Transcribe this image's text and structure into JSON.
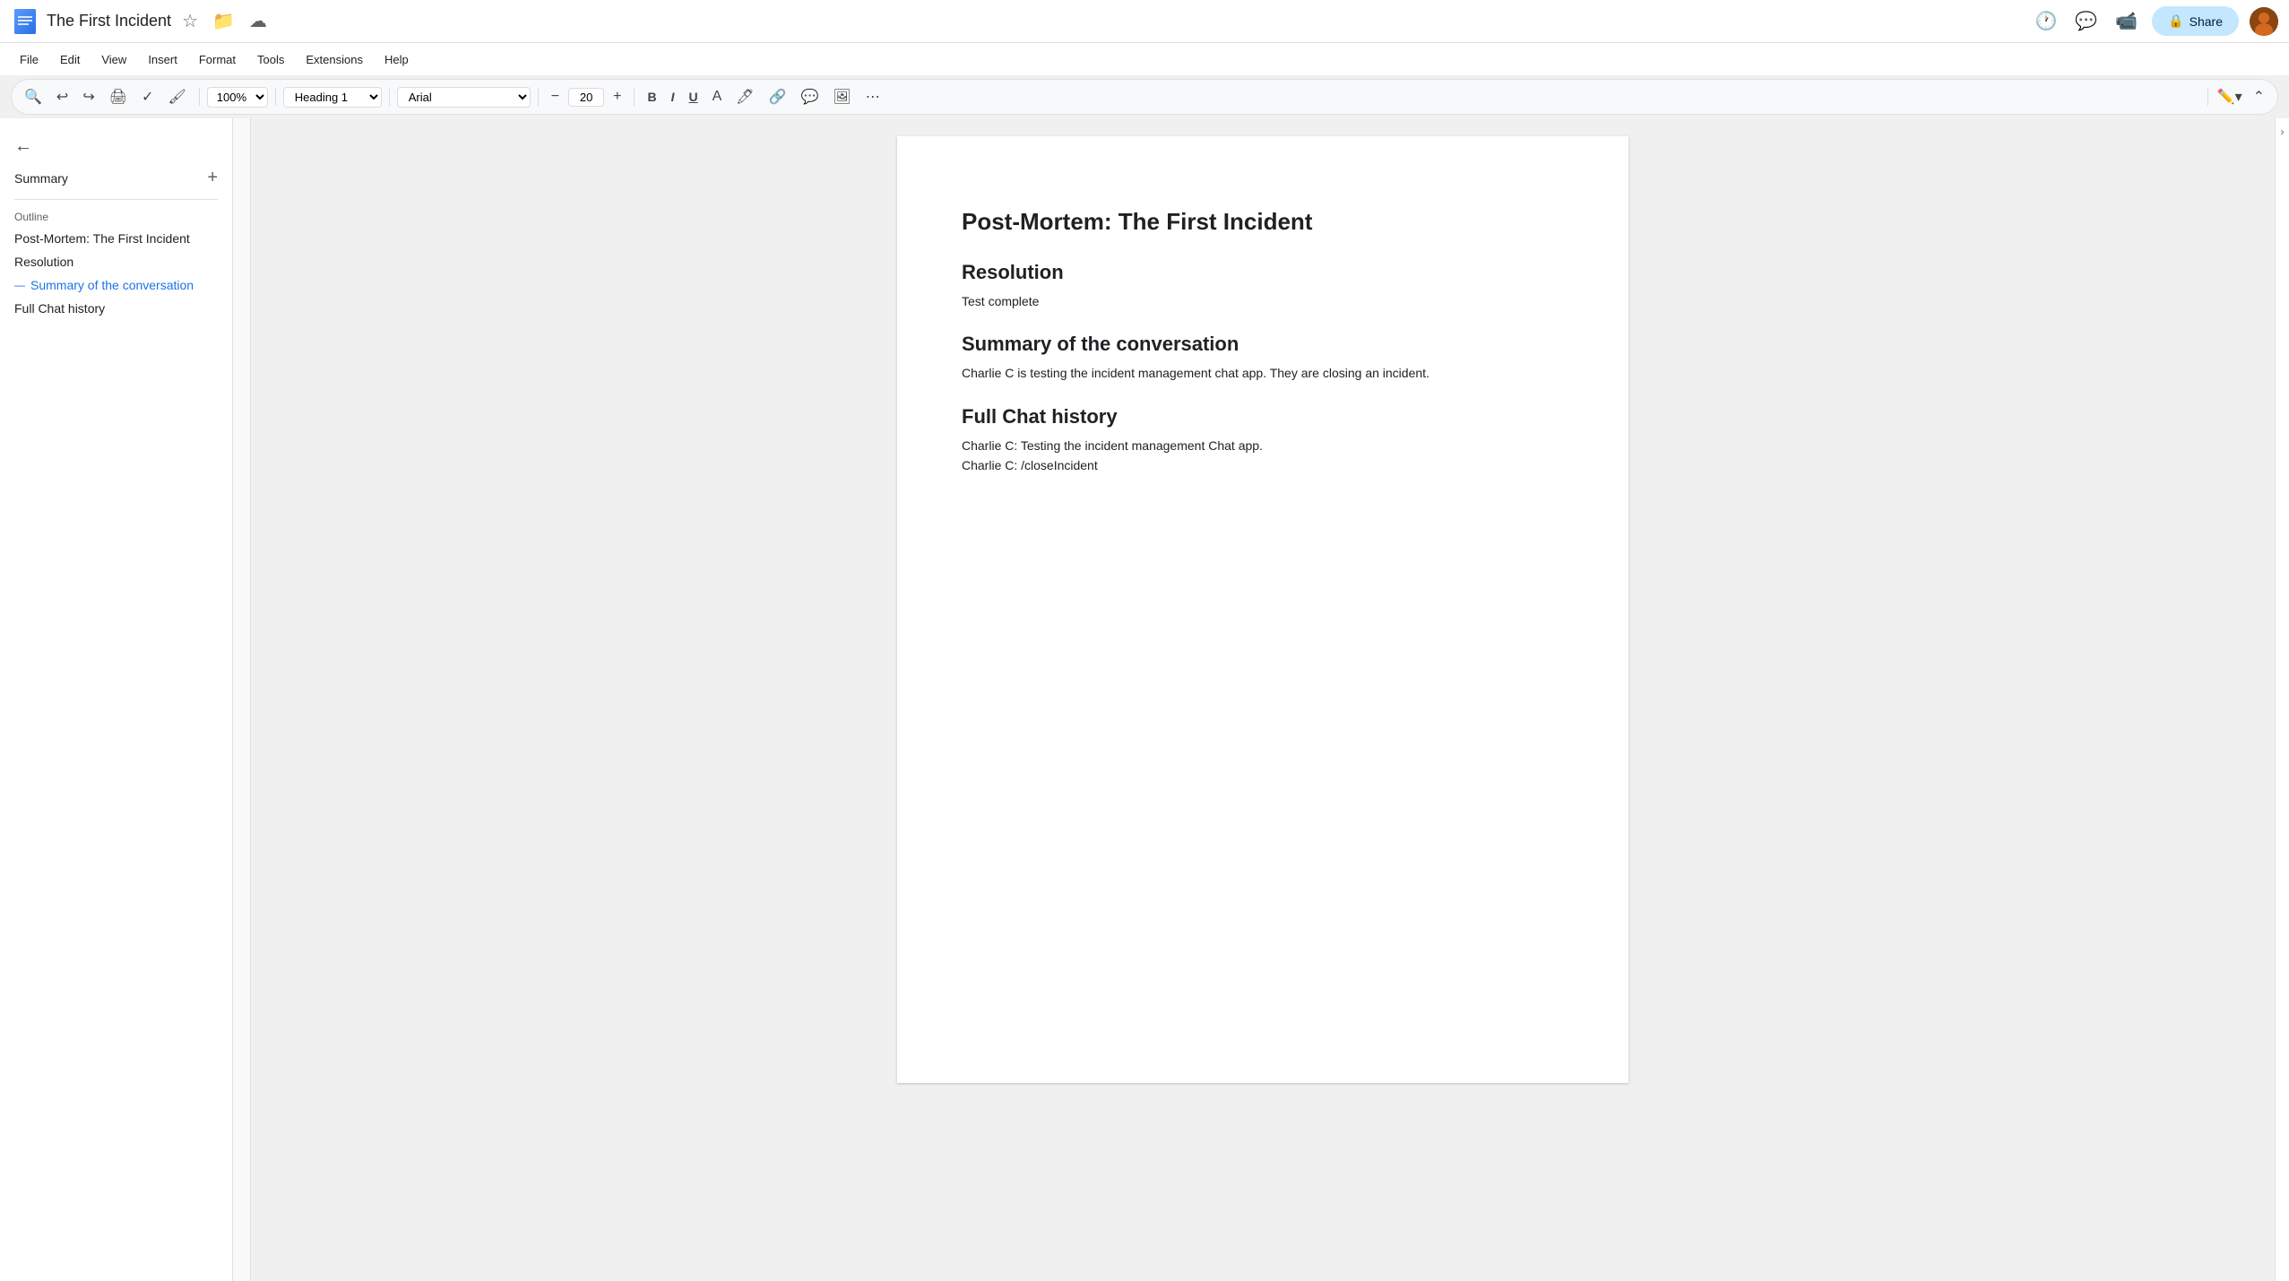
{
  "titleBar": {
    "docTitle": "The First Incident",
    "icons": [
      "star",
      "folder",
      "cloud"
    ],
    "shareLabel": "Share"
  },
  "menuBar": {
    "items": [
      "File",
      "Edit",
      "View",
      "Insert",
      "Format",
      "Tools",
      "Extensions",
      "Help"
    ]
  },
  "toolbar": {
    "zoom": "100%",
    "style": "Heading 1",
    "font": "Arial",
    "fontSize": "20",
    "boldLabel": "B",
    "italicLabel": "I",
    "underlineLabel": "U"
  },
  "sidebar": {
    "summaryLabel": "Summary",
    "outlineLabel": "Outline",
    "outlineItems": [
      {
        "label": "Post-Mortem: The First Incident",
        "active": false
      },
      {
        "label": "Resolution",
        "active": false
      },
      {
        "label": "Summary of the conversation",
        "active": true
      },
      {
        "label": "Full Chat history",
        "active": false
      }
    ]
  },
  "document": {
    "mainTitle": "Post-Mortem: The First Incident",
    "sections": [
      {
        "heading": "Resolution",
        "body": "Test complete"
      },
      {
        "heading": "Summary of the conversation",
        "body": "Charlie C is testing the incident management chat app. They are closing an incident."
      },
      {
        "heading": "Full Chat history",
        "lines": [
          "Charlie C: Testing the incident management Chat app.",
          "Charlie C: /closeIncident"
        ]
      }
    ]
  }
}
